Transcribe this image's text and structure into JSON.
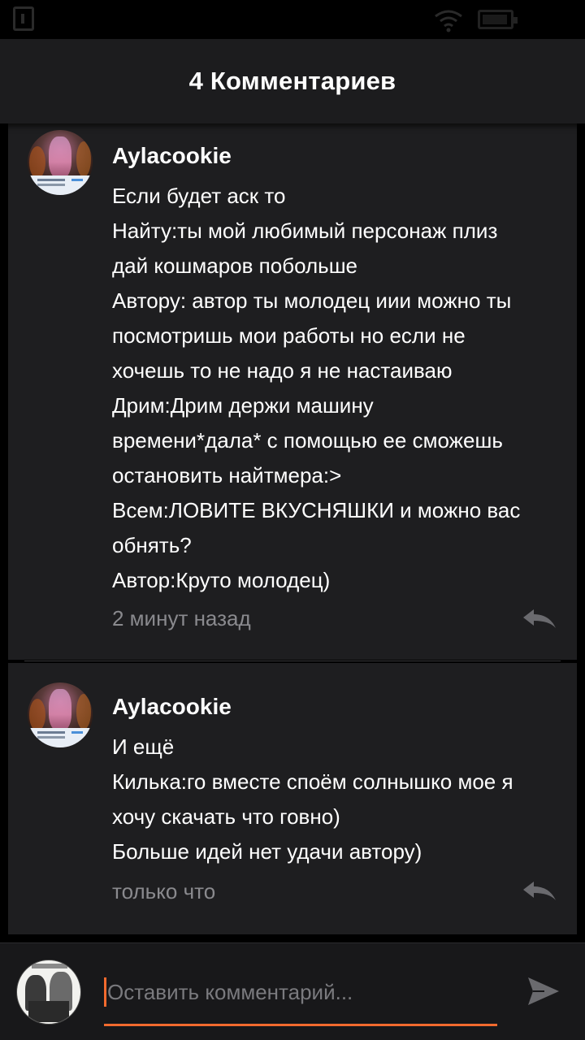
{
  "header": {
    "title": "4 Комментариев"
  },
  "comments": [
    {
      "author": "Aylacookie",
      "lines": [
        "Если будет аск то",
        "Найту:ты мой любимый персонаж плиз",
        "дай кошмаров побольше",
        "Автору: автор ты молодец иии можно ты",
        "посмотришь мои работы но если не",
        "хочешь то не надо я не настаиваю",
        "Дрим:Дрим держи машину",
        "времени*дала* с помощью ее сможешь",
        "остановить найтмера:>",
        "Всем:ЛОВИТЕ ВКУСНЯШКИ и можно вас",
        "обнять?",
        "Автор:Круто молодец)"
      ],
      "time": "2 минут назад",
      "reply_icon": "reply-arrow-icon"
    },
    {
      "author": "Aylacookie",
      "lines": [
        "И ещё",
        "Килька:го вместе споём солнышко мое я",
        "хочу скачать что говно)",
        "Больше идей нет удачи автору)"
      ],
      "time": "только что",
      "reply_icon": "reply-arrow-icon"
    }
  ],
  "composer": {
    "placeholder": "Оставить комментарий...",
    "send_icon": "send-icon"
  },
  "colors": {
    "background": "#000000",
    "card": "#1e1e20",
    "header": "#1c1c1e",
    "accent": "#f26a2e",
    "muted_text": "#8a8a8e"
  }
}
